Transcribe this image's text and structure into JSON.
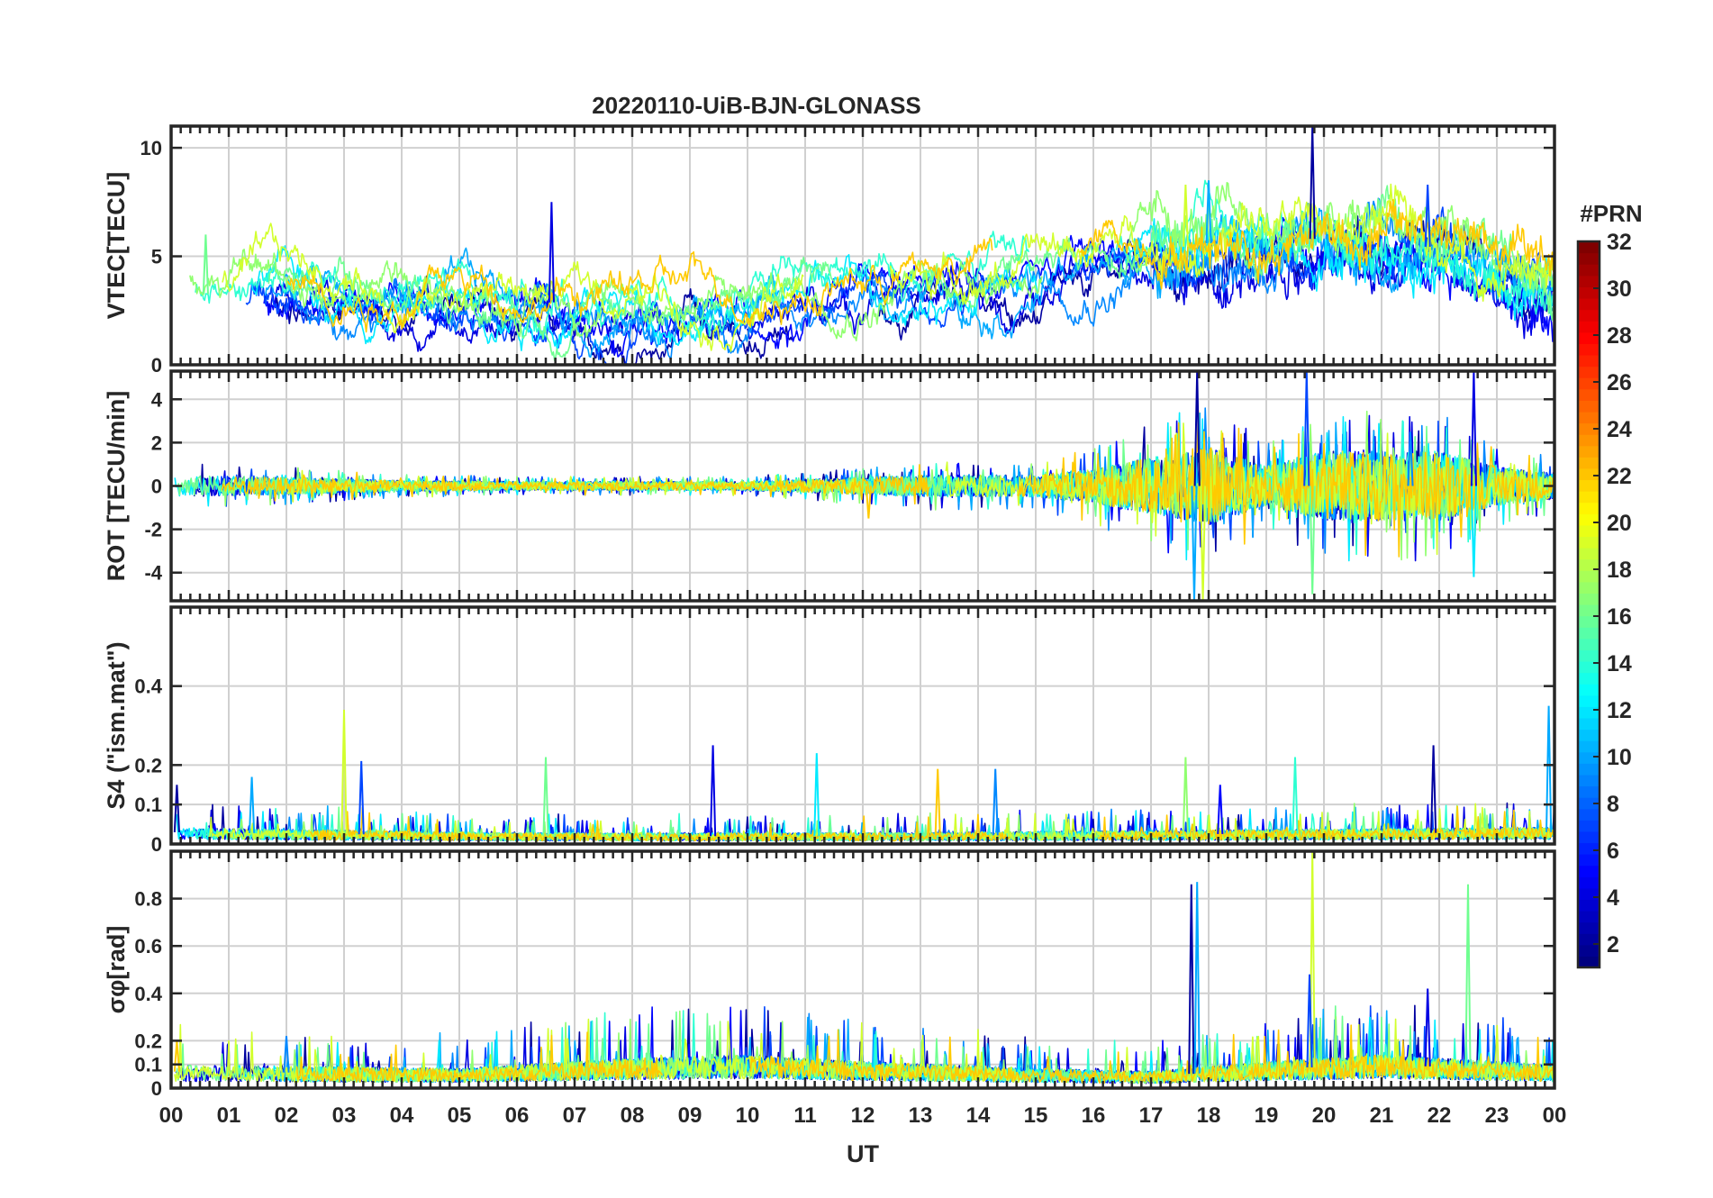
{
  "chart_data": {
    "type": "line",
    "title": "20220110-UiB-BJN-GLONASS",
    "xlabel": "UT",
    "x_ticks": [
      "00",
      "01",
      "02",
      "03",
      "04",
      "05",
      "06",
      "07",
      "08",
      "09",
      "10",
      "11",
      "12",
      "13",
      "14",
      "15",
      "16",
      "17",
      "18",
      "19",
      "20",
      "21",
      "22",
      "23",
      "00"
    ],
    "xlim": [
      0,
      24
    ],
    "grid": true,
    "colorbar": {
      "label": "#PRN",
      "range": [
        1,
        32
      ],
      "ticks": [
        "2",
        "4",
        "6",
        "8",
        "10",
        "12",
        "14",
        "16",
        "18",
        "20",
        "22",
        "24",
        "26",
        "28",
        "30",
        "32"
      ],
      "colormap": "jet"
    },
    "panels": [
      {
        "ylabel": "VTEC[TECU]",
        "ylim": [
          0,
          11
        ],
        "yticks": [
          "0",
          "5",
          "10"
        ],
        "ytick_values": [
          0,
          5,
          10
        ],
        "profile": [
          [
            0,
            3.2
          ],
          [
            2,
            3.4
          ],
          [
            4,
            3.1
          ],
          [
            6,
            3.0
          ],
          [
            8,
            2.6
          ],
          [
            10,
            2.8
          ],
          [
            12,
            3.4
          ],
          [
            13.5,
            3.8
          ],
          [
            15,
            4.3
          ],
          [
            16,
            4.8
          ],
          [
            17,
            5.2
          ],
          [
            18,
            5.6
          ],
          [
            19,
            5.4
          ],
          [
            20,
            5.9
          ],
          [
            21,
            5.6
          ],
          [
            22,
            5.4
          ],
          [
            23,
            4.4
          ],
          [
            24,
            3.6
          ]
        ],
        "spikes": [
          [
            19.8,
            11.0
          ],
          [
            18.0,
            8.5
          ],
          [
            17.6,
            8.3
          ],
          [
            21.8,
            8.3
          ],
          [
            0.6,
            6.0
          ],
          [
            6.6,
            7.5
          ]
        ]
      },
      {
        "ylabel": "ROT [TECU/min]",
        "ylim": [
          -5.3,
          5.3
        ],
        "yticks": [
          "-4",
          "-2",
          "0",
          "2",
          "4"
        ],
        "ytick_values": [
          -4,
          -2,
          0,
          2,
          4
        ],
        "amplitude": [
          [
            0,
            0.5
          ],
          [
            2,
            0.4
          ],
          [
            4,
            0.25
          ],
          [
            6,
            0.2
          ],
          [
            8,
            0.2
          ],
          [
            10,
            0.2
          ],
          [
            12,
            0.4
          ],
          [
            13,
            0.5
          ],
          [
            15,
            0.5
          ],
          [
            16,
            0.8
          ],
          [
            17,
            1.3
          ],
          [
            18,
            1.8
          ],
          [
            19,
            0.9
          ],
          [
            20,
            1.6
          ],
          [
            21,
            1.6
          ],
          [
            22,
            1.6
          ],
          [
            23,
            0.9
          ],
          [
            24,
            0.6
          ]
        ],
        "spikes": [
          [
            17.8,
            5.3
          ],
          [
            17.75,
            -5.3
          ],
          [
            17.9,
            -5.3
          ],
          [
            19.7,
            5.3
          ],
          [
            19.8,
            -5.0
          ],
          [
            22.6,
            5.3
          ],
          [
            22.6,
            -4.2
          ],
          [
            12.1,
            -1.5
          ],
          [
            21.5,
            2.5
          ]
        ]
      },
      {
        "ylabel": "S4 (\"ism.mat\")",
        "ylim": [
          0,
          0.6
        ],
        "yticks": [
          "0",
          "0.1",
          "0.2",
          "0.4"
        ],
        "ytick_values": [
          0,
          0.1,
          0.2,
          0.4
        ],
        "baseline": [
          [
            0,
            0.03
          ],
          [
            6,
            0.02
          ],
          [
            12,
            0.02
          ],
          [
            18,
            0.025
          ],
          [
            24,
            0.03
          ]
        ],
        "spikes": [
          [
            0.1,
            0.15
          ],
          [
            1.4,
            0.17
          ],
          [
            3.0,
            0.34
          ],
          [
            3.3,
            0.21
          ],
          [
            6.5,
            0.22
          ],
          [
            9.4,
            0.25
          ],
          [
            11.2,
            0.23
          ],
          [
            13.3,
            0.19
          ],
          [
            14.3,
            0.19
          ],
          [
            17.6,
            0.22
          ],
          [
            18.2,
            0.15
          ],
          [
            19.5,
            0.22
          ],
          [
            21.9,
            0.25
          ],
          [
            23.9,
            0.35
          ]
        ]
      },
      {
        "ylabel": "σφ[rad]",
        "ylim": [
          0,
          1.0
        ],
        "yticks": [
          "0",
          "0.1",
          "0.2",
          "0.4",
          "0.6",
          "0.8"
        ],
        "ytick_values": [
          0,
          0.1,
          0.2,
          0.4,
          0.6,
          0.8
        ],
        "baseline": [
          [
            0,
            0.07
          ],
          [
            5,
            0.06
          ],
          [
            8,
            0.09
          ],
          [
            10,
            0.1
          ],
          [
            12,
            0.08
          ],
          [
            15,
            0.06
          ],
          [
            17,
            0.05
          ],
          [
            19,
            0.08
          ],
          [
            21,
            0.1
          ],
          [
            24,
            0.07
          ]
        ],
        "spikes": [
          [
            17.7,
            0.86
          ],
          [
            17.8,
            0.87
          ],
          [
            19.8,
            1.0
          ],
          [
            19.75,
            0.48
          ],
          [
            22.5,
            0.86
          ],
          [
            21.8,
            0.42
          ],
          [
            20.8,
            0.3
          ],
          [
            0.1,
            0.2
          ],
          [
            2.0,
            0.22
          ]
        ]
      }
    ]
  }
}
